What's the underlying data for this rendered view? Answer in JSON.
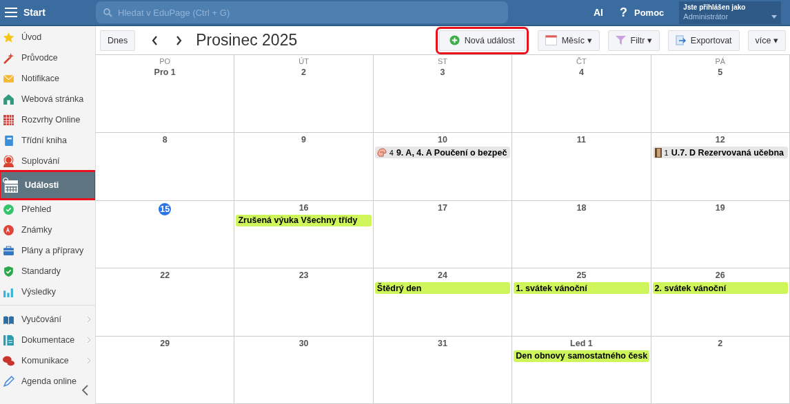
{
  "topbar": {
    "title": "Start",
    "search": {
      "placeholder": "Hledat v EduPage (Ctrl + G)"
    },
    "ai": "AI",
    "help_glyph": "?",
    "help": "Pomoc",
    "user": {
      "caption": "Jste přihlášen jako",
      "name": "Administrátor"
    }
  },
  "sidebar": {
    "items": [
      {
        "label": "Úvod",
        "selected": false,
        "highlighted": false,
        "submenu": false
      },
      {
        "label": "Průvodce",
        "selected": false,
        "highlighted": false,
        "submenu": false
      },
      {
        "label": "Notifikace",
        "selected": false,
        "highlighted": false,
        "submenu": false
      },
      {
        "label": "Webová stránka",
        "selected": false,
        "highlighted": false,
        "submenu": false
      },
      {
        "label": "Rozvrhy Online",
        "selected": false,
        "highlighted": false,
        "submenu": false
      },
      {
        "label": "Třídní kniha",
        "selected": false,
        "highlighted": false,
        "submenu": false
      },
      {
        "label": "Suplování",
        "selected": false,
        "highlighted": false,
        "submenu": false
      },
      {
        "label": "Události",
        "selected": true,
        "highlighted": true,
        "submenu": false
      },
      {
        "label": "Přehled",
        "selected": false,
        "highlighted": false,
        "submenu": false
      },
      {
        "label": "Známky",
        "selected": false,
        "highlighted": false,
        "submenu": false
      },
      {
        "label": "Plány a přípravy",
        "selected": false,
        "highlighted": false,
        "submenu": false
      },
      {
        "label": "Standardy",
        "selected": false,
        "highlighted": false,
        "submenu": false
      },
      {
        "label": "Výsledky",
        "selected": false,
        "highlighted": false,
        "submenu": false
      },
      {
        "label": "Vyučování",
        "selected": false,
        "highlighted": false,
        "submenu": true
      },
      {
        "label": "Dokumentace",
        "selected": false,
        "highlighted": false,
        "submenu": true
      },
      {
        "label": "Komunikace",
        "selected": false,
        "highlighted": false,
        "submenu": true
      },
      {
        "label": "Agenda online",
        "selected": false,
        "highlighted": false,
        "submenu": false
      }
    ]
  },
  "toolbar": {
    "today": "Dnes",
    "title": "Prosinec 2025",
    "buttons": [
      {
        "kind": "new",
        "label": "Nová událost",
        "highlighted": true
      },
      {
        "kind": "view",
        "label": "Měsíc ▾"
      },
      {
        "kind": "filter",
        "label": "Filtr ▾"
      },
      {
        "kind": "export",
        "label": "Exportovat"
      },
      {
        "kind": "more",
        "label": "více ▾"
      }
    ]
  },
  "calendar": {
    "weekdays": [
      "PO",
      "ÚT",
      "ST",
      "ČT",
      "PÁ"
    ],
    "weeks": [
      [
        {
          "label": "Pro 1",
          "today": false
        },
        {
          "label": "2",
          "today": false
        },
        {
          "label": "3",
          "today": false
        },
        {
          "label": "4",
          "today": false
        },
        {
          "label": "5",
          "today": false
        }
      ],
      [
        {
          "label": "8",
          "today": false
        },
        {
          "label": "9",
          "today": false
        },
        {
          "label": "10",
          "today": false,
          "events": [
            {
              "kind": "lesson",
              "count": "4",
              "text": "9. A, 4. A Poučení o bezpeč"
            }
          ]
        },
        {
          "label": "11",
          "today": false
        },
        {
          "label": "12",
          "today": false,
          "events": [
            {
              "kind": "room",
              "count": "1",
              "text": "U.7. D Rezervovaná učebna"
            }
          ]
        }
      ],
      [
        {
          "label": "15",
          "today": true
        },
        {
          "label": "16",
          "today": false,
          "events": [
            {
              "kind": "holiday",
              "text": "Zrušená výuka Všechny třídy"
            }
          ]
        },
        {
          "label": "17",
          "today": false
        },
        {
          "label": "18",
          "today": false
        },
        {
          "label": "19",
          "today": false
        }
      ],
      [
        {
          "label": "22",
          "today": false
        },
        {
          "label": "23",
          "today": false
        },
        {
          "label": "24",
          "today": false,
          "events": [
            {
              "kind": "holiday",
              "text": "Štědrý den"
            }
          ]
        },
        {
          "label": "25",
          "today": false,
          "events": [
            {
              "kind": "holiday",
              "text": "1. svátek vánoční"
            }
          ]
        },
        {
          "label": "26",
          "today": false,
          "events": [
            {
              "kind": "holiday",
              "text": "2. svátek vánoční"
            }
          ]
        }
      ],
      [
        {
          "label": "29",
          "today": false
        },
        {
          "label": "30",
          "today": false
        },
        {
          "label": "31",
          "today": false
        },
        {
          "label": "Led 1",
          "today": false,
          "events": [
            {
              "kind": "holiday",
              "text": "Den obnovy samostatného česk"
            }
          ]
        },
        {
          "label": "2",
          "today": false
        }
      ]
    ]
  }
}
